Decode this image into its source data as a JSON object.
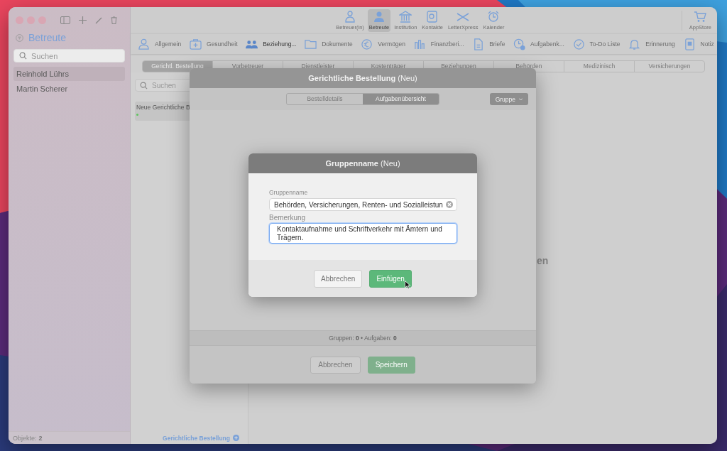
{
  "sidebar": {
    "title": "Betreute",
    "search": {
      "placeholder": "Suchen"
    },
    "items": [
      {
        "label": "Reinhold Lührs",
        "selected": true
      },
      {
        "label": "Martin Scherer",
        "selected": false
      }
    ],
    "footer": {
      "label": "Objekte:",
      "count": "2"
    }
  },
  "toolbar": {
    "items": [
      {
        "label": "Betreuer(in)",
        "selected": false
      },
      {
        "label": "Betreute",
        "selected": true
      },
      {
        "label": "Institution",
        "selected": false
      },
      {
        "label": "Kontakte",
        "selected": false
      },
      {
        "label": "LetterXpress",
        "selected": false
      },
      {
        "label": "Kalender",
        "selected": false
      }
    ],
    "store": "AppStore"
  },
  "modules": [
    {
      "label": "Allgemein",
      "selected": false
    },
    {
      "label": "Gesundheit",
      "selected": false
    },
    {
      "label": "Beziehung...",
      "selected": true
    },
    {
      "label": "Dokumente",
      "selected": false
    },
    {
      "label": "Vermögen",
      "selected": false
    },
    {
      "label": "Finanzberi...",
      "selected": false
    },
    {
      "label": "Briefe",
      "selected": false
    },
    {
      "label": "Aufgabenk...",
      "selected": false
    },
    {
      "label": "To-Do Liste",
      "selected": false
    },
    {
      "label": "Erinnerung",
      "selected": false
    },
    {
      "label": "Notiz",
      "selected": false
    }
  ],
  "record_tabs": [
    {
      "label": "Gerichtl. Bestellung",
      "selected": true
    },
    {
      "label": "Vorbetreuer",
      "selected": false
    },
    {
      "label": "Dienstleister",
      "selected": false
    },
    {
      "label": "Kostenträger",
      "selected": false
    },
    {
      "label": "Beziehungen",
      "selected": false
    },
    {
      "label": "Behörden",
      "selected": false
    },
    {
      "label": "Medizinisch",
      "selected": false
    },
    {
      "label": "Versicherungen",
      "selected": false
    }
  ],
  "list": {
    "search": {
      "placeholder": "Suchen"
    },
    "items": [
      {
        "title": "Neue Gerichtliche B",
        "color": "#5dc55d"
      }
    ],
    "add_link": "Gerichtliche Bestellung"
  },
  "main": {
    "empty_text": "en"
  },
  "sheet": {
    "title": "**Gerichtliche Bestellung** (Neu)",
    "segments": [
      {
        "label": "Bestelldetails",
        "selected": false
      },
      {
        "label": "Aufgabenübersicht",
        "selected": true
      }
    ],
    "group_button": "Gruppe",
    "summary": "Gruppen: **0** • Aufgaben: **0**",
    "buttons": [
      {
        "label": "Abbrechen",
        "kind": "secondary"
      },
      {
        "label": "Speichern",
        "kind": "primary"
      }
    ]
  },
  "dialog": {
    "title": "**Gruppenname** (Neu)",
    "fields": [
      {
        "label": "Gruppenname",
        "value": "Behörden, Versicherungen, Renten- und Sozialleistun",
        "kind": "text",
        "focused": false
      },
      {
        "label": "Bemerkung",
        "value": "Kontaktaufnahme und Schriftverkehr mit Ämtern und Trägern.",
        "kind": "textarea",
        "focused": true
      }
    ],
    "buttons": [
      {
        "label": "Abbrechen",
        "kind": "secondary"
      },
      {
        "label": "Einfügen",
        "kind": "primary"
      }
    ]
  }
}
